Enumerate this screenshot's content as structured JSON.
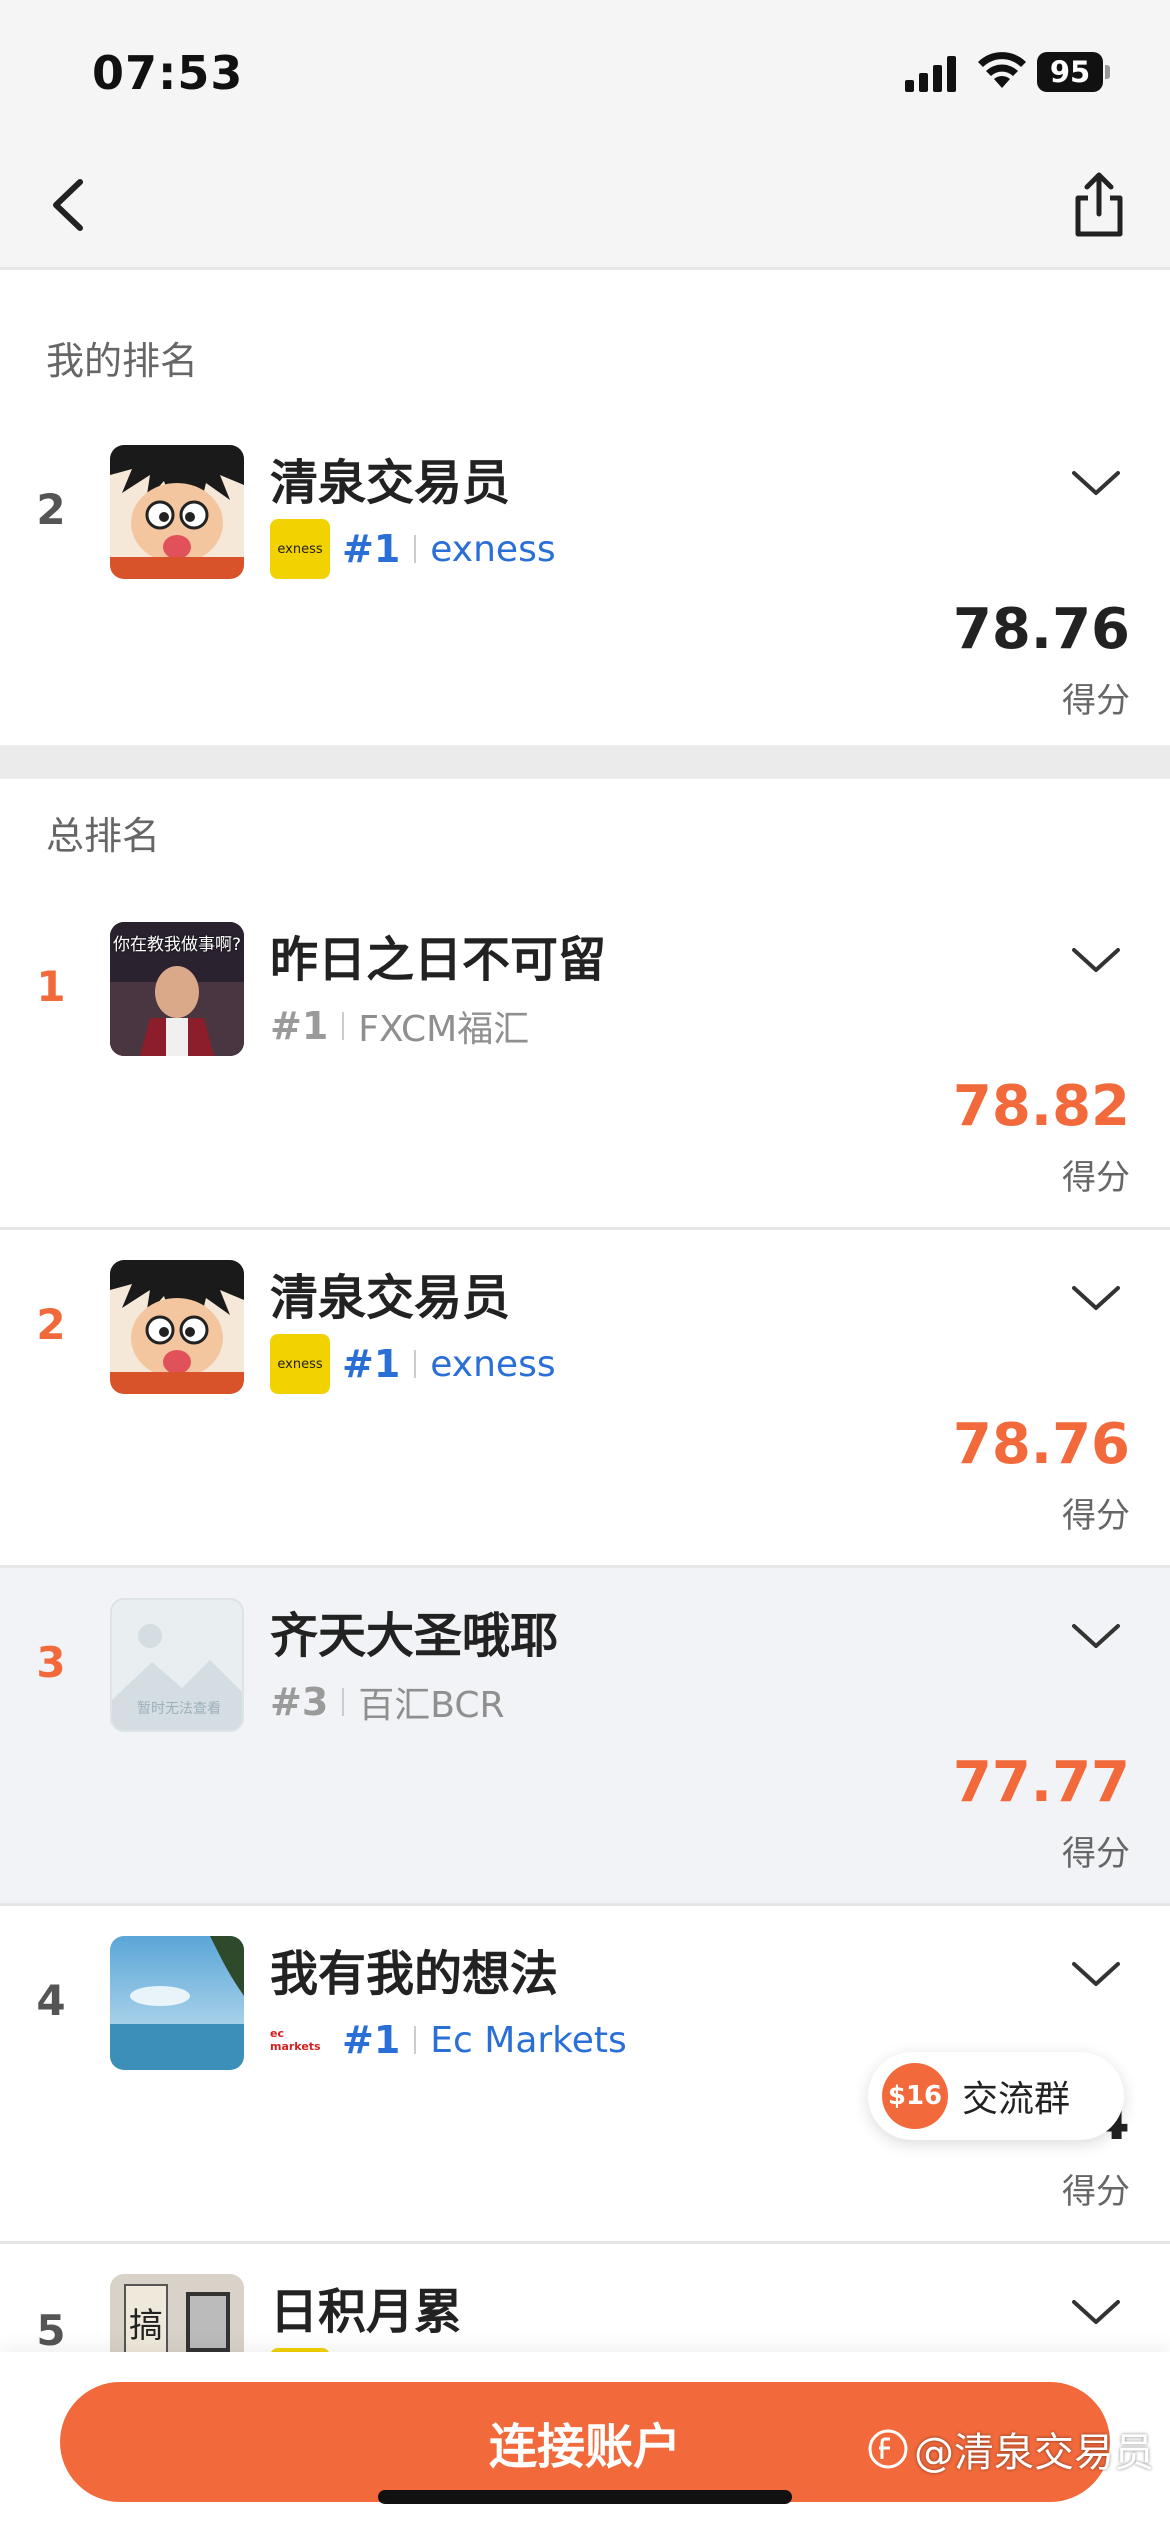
{
  "status_bar": {
    "time": "07:53",
    "battery": "95"
  },
  "my_ranking": {
    "label": "我的排名",
    "entry": {
      "rank": "2",
      "name": "清泉交易员",
      "rank_tag": "#1",
      "broker": "exness",
      "broker_logo_text": "exness",
      "score": "78.76",
      "score_label": "得分"
    }
  },
  "overall_ranking": {
    "label": "总排名",
    "entries": [
      {
        "rank": "1",
        "name": "昨日之日不可留",
        "rank_tag": "#1",
        "broker": "FXCM福汇",
        "score": "78.82",
        "score_label": "得分",
        "avatar_caption": "你在教我做事啊?"
      },
      {
        "rank": "2",
        "name": "清泉交易员",
        "rank_tag": "#1",
        "broker": "exness",
        "broker_logo_text": "exness",
        "score": "78.76",
        "score_label": "得分"
      },
      {
        "rank": "3",
        "name": "齐天大圣哦耶",
        "rank_tag": "#3",
        "broker": "百汇BCR",
        "score": "77.77",
        "score_label": "得分",
        "avatar_caption": "暂时无法查看"
      },
      {
        "rank": "4",
        "name": "我有我的想法",
        "rank_tag": "#1",
        "broker": "Ec Markets",
        "broker_logo_text": "ec markets",
        "score": "76.04",
        "score_label": "得分"
      },
      {
        "rank": "5",
        "name": "日积月累",
        "avatar_caption": "搞"
      }
    ]
  },
  "floating_chat": {
    "coin": "$16",
    "label": "交流群"
  },
  "bottom": {
    "connect_button": "连接账户"
  },
  "watermark": "@清泉交易员",
  "colors": {
    "accent": "#f26a3b",
    "link": "#2a6fd6",
    "exness_yellow": "#f2d200"
  }
}
